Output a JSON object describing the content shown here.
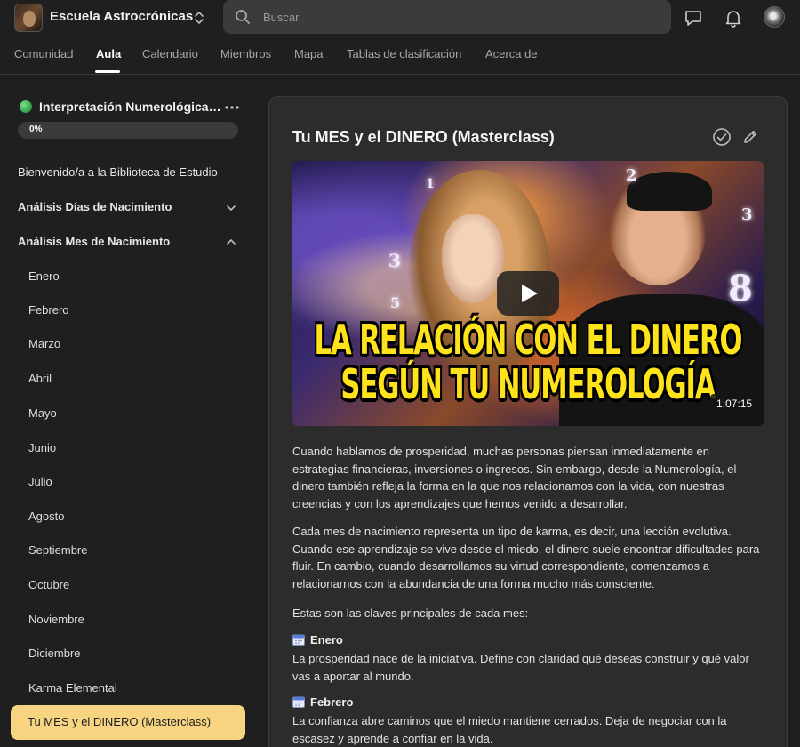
{
  "header": {
    "app_name": "Escuela Astrocrónicas",
    "search_placeholder": "Buscar",
    "icons": [
      "switch-icon",
      "search-icon",
      "chat-icon",
      "bell-icon",
      "avatar"
    ]
  },
  "tabs": [
    {
      "label": "Comunidad",
      "active": false
    },
    {
      "label": "Aula",
      "active": true
    },
    {
      "label": "Calendario",
      "active": false
    },
    {
      "label": "Miembros",
      "active": false
    },
    {
      "label": "Mapa",
      "active": false
    },
    {
      "label": "Tablas de clasificación",
      "active": false
    },
    {
      "label": "Acerca de",
      "active": false
    }
  ],
  "sidebar": {
    "course_title": "Interpretación Numerológica ...",
    "progress_label": "0%",
    "progress_value": 0,
    "sections": [
      {
        "label": "Bienvenido/a a la Biblioteca de Estudio"
      },
      {
        "label": "Análisis Días de Nacimiento",
        "expanded": false
      },
      {
        "label": "Análisis Mes de Nacimiento",
        "expanded": true
      }
    ],
    "months": [
      "Enero",
      "Febrero",
      "Marzo",
      "Abril",
      "Mayo",
      "Junio",
      "Julio",
      "Agosto",
      "Septiembre",
      "Octubre",
      "Noviembre",
      "Diciembre",
      "Karma Elemental"
    ],
    "active_item": "Tu MES y el DINERO (Masterclass)",
    "active_color": "#f7d482"
  },
  "lesson": {
    "title": "Tu MES y el DINERO (Masterclass)",
    "video": {
      "headline_1": "LA RELACIÓN CON EL DINERO",
      "headline_2": "SEGÚN TU NUMEROLOGÍA",
      "duration": "1:07:15",
      "headline_color": "#ffe31a"
    },
    "paragraphs": [
      "Cuando hablamos de prosperidad, muchas personas piensan inmediatamente en estrategias financieras, inversiones o ingresos. Sin embargo, desde la Numerología, el dinero también refleja la forma en la que nos relacionamos con la vida, con nuestras creencias y con los aprendizajes que hemos venido a desarrollar.",
      "Cada mes de nacimiento representa un tipo de karma, es decir, una lección evolutiva. Cuando ese aprendizaje se vive desde el miedo, el dinero suele encontrar dificultades para fluir. En cambio, cuando desarrollamos su virtud correspondiente, comenzamos a relacionarnos con la abundancia de una forma mucho más consciente.",
      "Estas son las claves principales de cada mes:"
    ],
    "months": [
      {
        "name": "Enero",
        "text": "La prosperidad nace de la iniciativa. Define con claridad qué deseas construir y qué valor vas a aportar al mundo."
      },
      {
        "name": "Febrero",
        "text": "La confianza abre caminos que el miedo mantiene cerrados. Deja de negociar con la escasez y aprende a confiar en la vida."
      }
    ]
  }
}
